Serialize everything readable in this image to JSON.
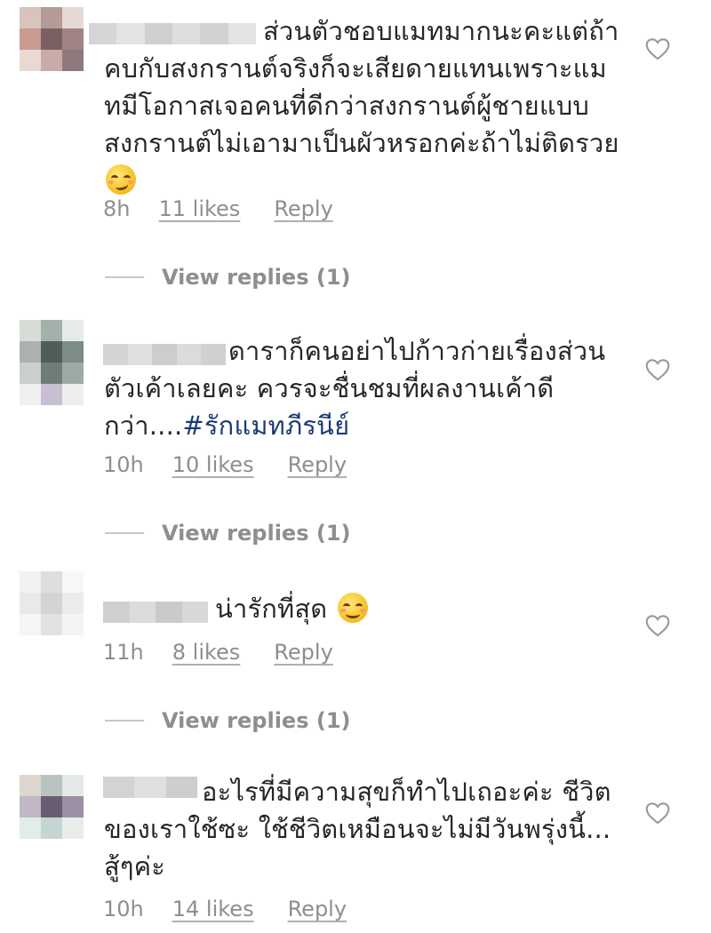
{
  "comments": [
    {
      "text": "ส่วนตัวชอบแมทมากนะคะแต่ถ้า\nคบกับสงกรานต์จริงก็จะเสียดายแทนเพราะแม\nทมีโอกาสเจอคนที่ดีกว่าสงกรานต์ผู้ชายแบบ\nสงกรานต์ไม่เอามาเป็นผัวหรอกค่ะถ้าไม่ติดรวย",
      "emoji": "smirk-emoji",
      "time": "8h",
      "likes": "11 likes",
      "reply": "Reply",
      "view_replies": "View replies (1)"
    },
    {
      "text_plain": "ดาราก็คนอย่าไปก้าวก่ายเรื่องส่วน\nตัวเค้าเลยคะ ควรจะชื่นชมที่ผลงานเค้าดี\nกว่า....",
      "hashtag": "#รักแมทภีรนีย์",
      "time": "10h",
      "likes": "10 likes",
      "reply": "Reply",
      "view_replies": "View replies (1)"
    },
    {
      "text": "น่ารักที่สุด",
      "emoji": "smile-emoji",
      "time": "11h",
      "likes": "8 likes",
      "reply": "Reply",
      "view_replies": "View replies (1)"
    },
    {
      "text": "อะไรที่มีความสุขก็ทำไปเถอะค่ะ ชีวิต\nของเราใช้ซะ ใช้ชีวิตเหมือนจะไม่มีวันพรุ่งนี้...\nสู้ๆค่ะ",
      "time": "10h",
      "likes": "14 likes",
      "reply": "Reply"
    }
  ],
  "icons": {
    "like": "heart-outline-icon"
  },
  "colors": {
    "text": "#262626",
    "meta": "#8e8e8e",
    "hashtag": "#1b3b73",
    "heart": "#9a9a9a"
  }
}
